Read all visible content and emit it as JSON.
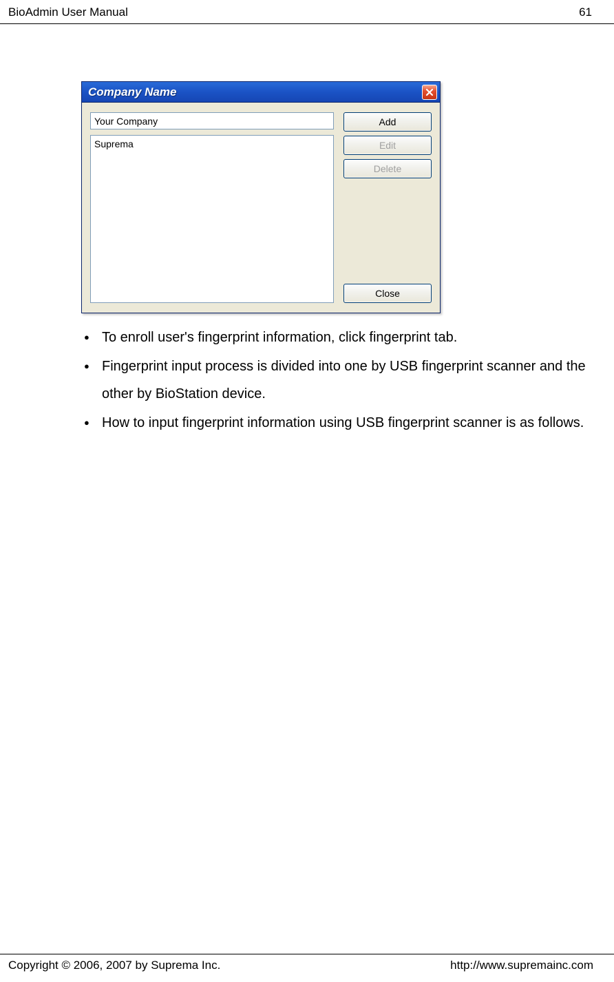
{
  "header": {
    "title": "BioAdmin User Manual",
    "page_number": "61"
  },
  "footer": {
    "copyright": "Copyright © 2006, 2007 by Suprema Inc.",
    "url": "http://www.supremainc.com"
  },
  "dialog": {
    "title": "Company Name",
    "input_value": "Your Company",
    "list_items": [
      "Suprema"
    ],
    "buttons": {
      "add": "Add",
      "edit": "Edit",
      "delete": "Delete",
      "close": "Close"
    }
  },
  "bullets": [
    "To enroll user's fingerprint information, click fingerprint tab.",
    "Fingerprint input process is divided into one by USB fingerprint scanner and the other by BioStation device.",
    "How to input fingerprint information using USB fingerprint scanner is as follows."
  ]
}
